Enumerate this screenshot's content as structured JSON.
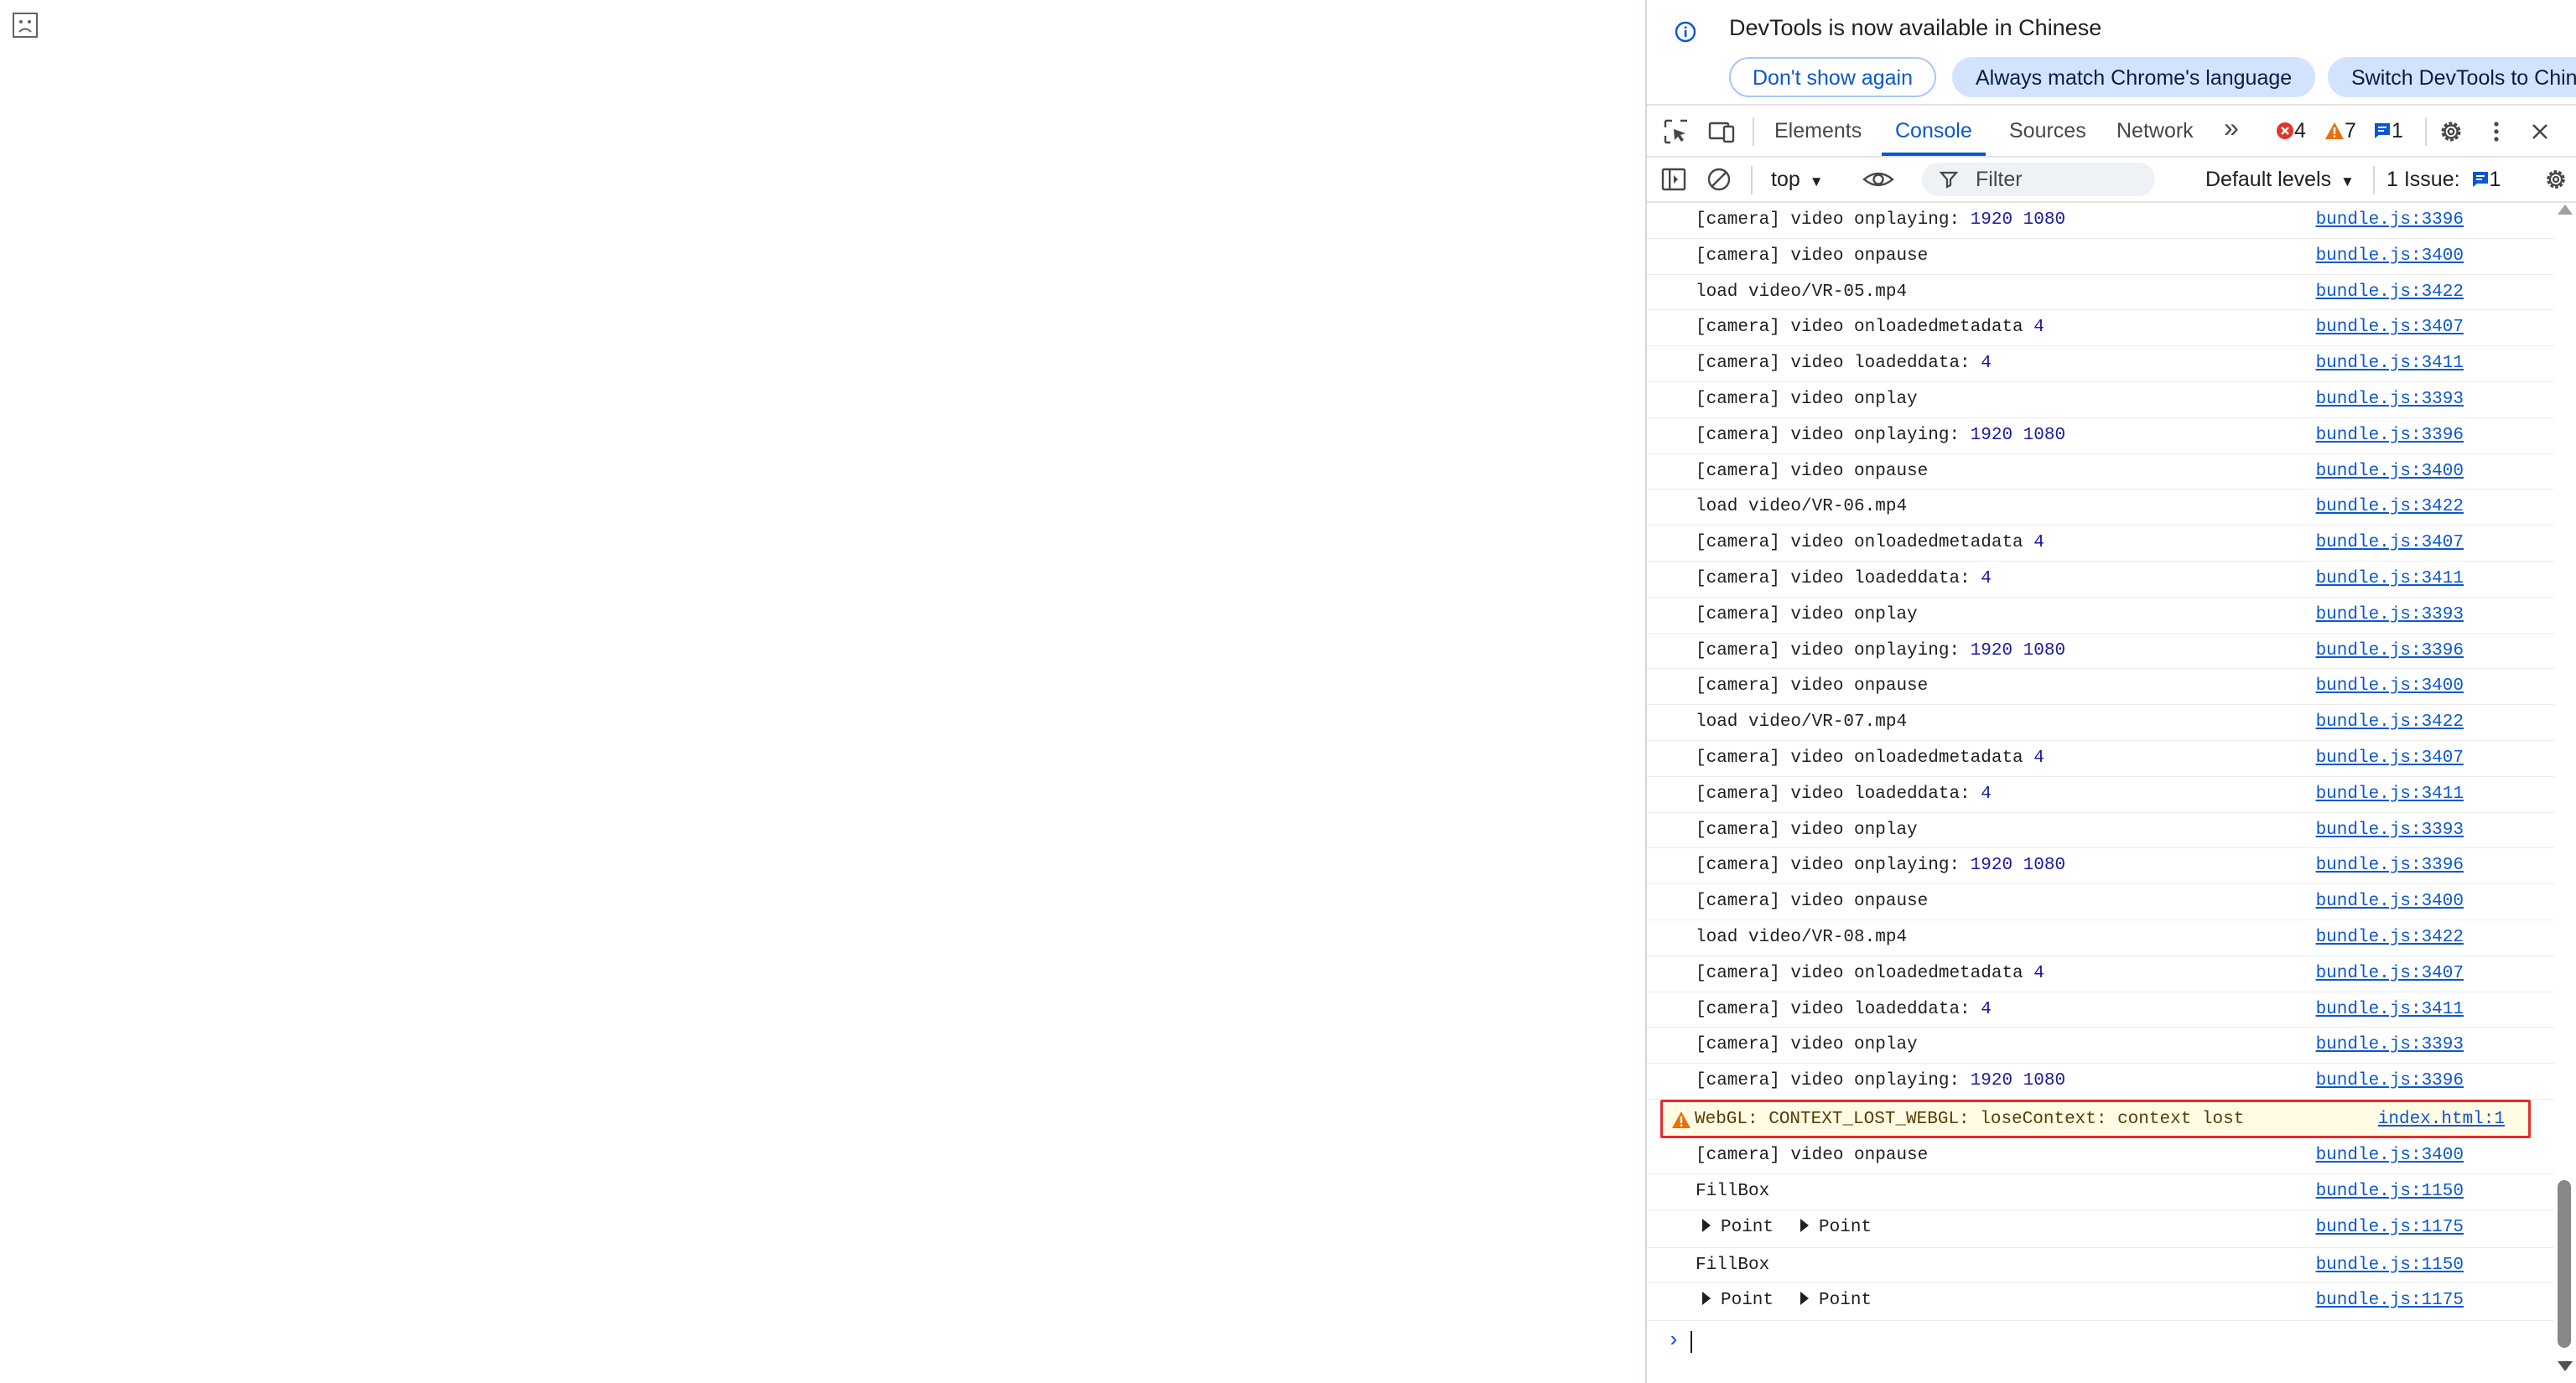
{
  "infobar": {
    "message": "DevTools is now available in Chinese",
    "btn_dont_show": "Don't show again",
    "btn_match_language": "Always match Chrome's language",
    "btn_switch": "Switch DevTools to Chinese"
  },
  "tabs": {
    "elements": "Elements",
    "console": "Console",
    "sources": "Sources",
    "network": "Network",
    "more": "»",
    "errors": "4",
    "warnings": "7",
    "messages": "1"
  },
  "console_toolbar": {
    "context": "top",
    "filter_placeholder": "Filter",
    "levels": "Default levels",
    "issues_label": "1 Issue:",
    "issues_count": "1"
  },
  "log": [
    {
      "text": "[camera] video onplaying: ",
      "num": "1920 1080",
      "src": "bundle.js:3396"
    },
    {
      "text": "[camera] video onpause",
      "num": "",
      "src": "bundle.js:3400"
    },
    {
      "text": "load video/VR-05.mp4",
      "num": "",
      "src": "bundle.js:3422"
    },
    {
      "text": "[camera] video onloadedmetadata ",
      "num": "4",
      "src": "bundle.js:3407"
    },
    {
      "text": "[camera] video loadeddata: ",
      "num": "4",
      "src": "bundle.js:3411"
    },
    {
      "text": "[camera] video onplay",
      "num": "",
      "src": "bundle.js:3393"
    },
    {
      "text": "[camera] video onplaying: ",
      "num": "1920 1080",
      "src": "bundle.js:3396"
    },
    {
      "text": "[camera] video onpause",
      "num": "",
      "src": "bundle.js:3400"
    },
    {
      "text": "load video/VR-06.mp4",
      "num": "",
      "src": "bundle.js:3422"
    },
    {
      "text": "[camera] video onloadedmetadata ",
      "num": "4",
      "src": "bundle.js:3407"
    },
    {
      "text": "[camera] video loadeddata: ",
      "num": "4",
      "src": "bundle.js:3411"
    },
    {
      "text": "[camera] video onplay",
      "num": "",
      "src": "bundle.js:3393"
    },
    {
      "text": "[camera] video onplaying: ",
      "num": "1920 1080",
      "src": "bundle.js:3396"
    },
    {
      "text": "[camera] video onpause",
      "num": "",
      "src": "bundle.js:3400"
    },
    {
      "text": "load video/VR-07.mp4",
      "num": "",
      "src": "bundle.js:3422"
    },
    {
      "text": "[camera] video onloadedmetadata ",
      "num": "4",
      "src": "bundle.js:3407"
    },
    {
      "text": "[camera] video loadeddata: ",
      "num": "4",
      "src": "bundle.js:3411"
    },
    {
      "text": "[camera] video onplay",
      "num": "",
      "src": "bundle.js:3393"
    },
    {
      "text": "[camera] video onplaying: ",
      "num": "1920 1080",
      "src": "bundle.js:3396"
    },
    {
      "text": "[camera] video onpause",
      "num": "",
      "src": "bundle.js:3400"
    },
    {
      "text": "load video/VR-08.mp4",
      "num": "",
      "src": "bundle.js:3422"
    },
    {
      "text": "[camera] video onloadedmetadata ",
      "num": "4",
      "src": "bundle.js:3407"
    },
    {
      "text": "[camera] video loadeddata: ",
      "num": "4",
      "src": "bundle.js:3411"
    },
    {
      "text": "[camera] video onplay",
      "num": "",
      "src": "bundle.js:3393"
    },
    {
      "text": "[camera] video onplaying: ",
      "num": "1920 1080",
      "src": "bundle.js:3396"
    }
  ],
  "warning": {
    "text": "WebGL: CONTEXT_LOST_WEBGL: loseContext: context lost",
    "src": "index.html:1"
  },
  "log_after": [
    {
      "text": "[camera] video onpause",
      "src": "bundle.js:3400"
    },
    {
      "text": "FillBox",
      "src": "bundle.js:1150"
    },
    {
      "obj1": "Point",
      "obj2": "Point",
      "src": "bundle.js:1175"
    },
    {
      "text": "FillBox",
      "src": "bundle.js:1150"
    },
    {
      "obj1": "Point",
      "obj2": "Point",
      "src": "bundle.js:1175"
    }
  ],
  "prompt_symbol": "›",
  "colors": {
    "accent": "#0b57d0",
    "error": "#dc362e",
    "warning": "#e8710a",
    "warning_bg": "#fffbe5",
    "highlight_border": "#e12d2d"
  },
  "icons": [
    "broken-image-icon",
    "info-icon",
    "inspect-element-icon",
    "device-toolbar-icon",
    "more-tabs-icon",
    "error-icon",
    "warning-icon",
    "message-icon",
    "settings-icon",
    "kebab-menu-icon",
    "close-icon",
    "sidebar-toggle-icon",
    "clear-console-icon",
    "eye-icon",
    "filter-icon",
    "dropdown-arrow-icon"
  ]
}
